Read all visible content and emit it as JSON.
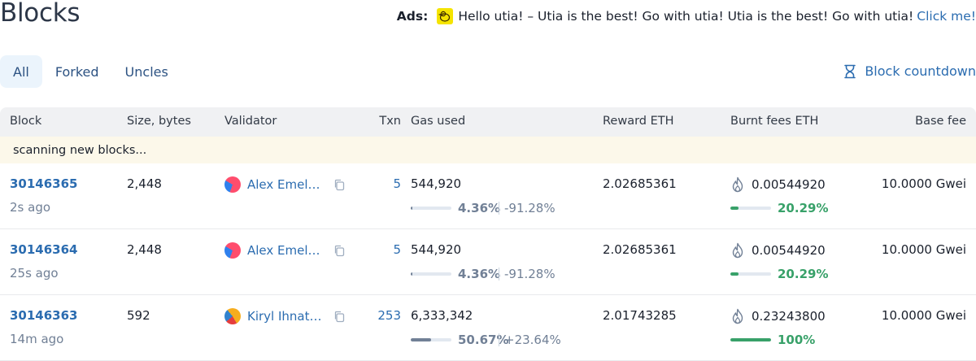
{
  "page": {
    "title": "Blocks"
  },
  "ads": {
    "label": "Ads:",
    "logo_icon": "utia-duck-icon",
    "text": "Hello utia! – Utia is the best! Go with utia! Utia is the best! Go with utia!",
    "link": "Click me!",
    "accent": "#f5e400"
  },
  "tabs": [
    {
      "label": "All",
      "active": true
    },
    {
      "label": "Forked",
      "active": false
    },
    {
      "label": "Uncles",
      "active": false
    }
  ],
  "countdown": {
    "label": "Block countdown",
    "icon": "hourglass-icon"
  },
  "table": {
    "headers": {
      "block": "Block",
      "size": "Size, bytes",
      "validator": "Validator",
      "txn": "Txn",
      "gas": "Gas used",
      "reward": "Reward ETH",
      "burnt": "Burnt fees ETH",
      "basefee": "Base fee"
    },
    "scanning": "scanning new blocks...",
    "rows": [
      {
        "block": "30146365",
        "age": "2s ago",
        "size": "2,448",
        "validator": "Alex Emelyanov",
        "avatar": "pink",
        "txn": "5",
        "gas_used": "544,920",
        "gas_pct": "4.36%",
        "gas_fraction": 0.0436,
        "gas_delta": "-91.28%",
        "reward": "2.02685361",
        "burnt": "0.00544920",
        "burnt_pct": "20.29%",
        "burnt_fraction": 0.2029,
        "basefee": "10.0000 Gwei"
      },
      {
        "block": "30146364",
        "age": "25s ago",
        "size": "2,448",
        "validator": "Alex Emelyanov",
        "avatar": "pink",
        "txn": "5",
        "gas_used": "544,920",
        "gas_pct": "4.36%",
        "gas_fraction": 0.0436,
        "gas_delta": "-91.28%",
        "reward": "2.02685361",
        "burnt": "0.00544920",
        "burnt_pct": "20.29%",
        "burnt_fraction": 0.2029,
        "basefee": "10.0000 Gwei"
      },
      {
        "block": "30146363",
        "age": "14m ago",
        "size": "592",
        "validator": "Kiryl Ihnatsyeu",
        "avatar": "orange",
        "txn": "253",
        "gas_used": "6,333,342",
        "gas_pct": "50.67%",
        "gas_fraction": 0.5067,
        "gas_delta": "+23.64%",
        "reward": "2.01743285",
        "burnt": "0.23243800",
        "burnt_pct": "100%",
        "burnt_fraction": 1.0,
        "basefee": "10.0000 Gwei"
      }
    ]
  },
  "colors": {
    "link": "#2b6cb0",
    "success": "#38a169",
    "gas_fill": "#718096",
    "scanning_bg": "#fcf8ea"
  }
}
